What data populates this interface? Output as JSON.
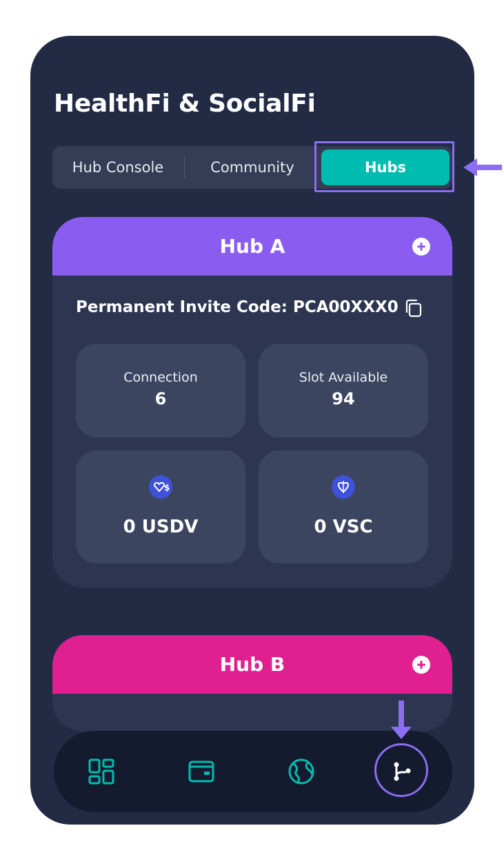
{
  "app": {
    "title": "HealthFi & SocialFi"
  },
  "tabs": [
    {
      "label": "Hub Console",
      "active": false
    },
    {
      "label": "Community",
      "active": false
    },
    {
      "label": "Hubs",
      "active": true
    }
  ],
  "hubs": [
    {
      "name": "Hub A",
      "header_color": "#8b5cf0",
      "invite_label": "Permanent Invite Code:",
      "invite_code": "PCA00XXX0",
      "stats": {
        "connection": {
          "label": "Connection",
          "value": "6"
        },
        "slot": {
          "label": "Slot Available",
          "value": "94"
        }
      },
      "balances": [
        {
          "icon": "usdv-coin-icon",
          "value": "0 USDV"
        },
        {
          "icon": "vsc-coin-icon",
          "value": "0 VSC"
        }
      ]
    },
    {
      "name": "Hub B",
      "header_color": "#e01f90"
    }
  ],
  "nav": {
    "items": [
      {
        "icon": "dashboard-icon",
        "active": false
      },
      {
        "icon": "wallet-icon",
        "active": false
      },
      {
        "icon": "globe-icon",
        "active": false
      },
      {
        "icon": "hubs-branch-icon",
        "active": true
      }
    ]
  },
  "colors": {
    "background": "#222a44",
    "accent_teal": "#00bcb0",
    "highlight": "#8b6ff0"
  }
}
